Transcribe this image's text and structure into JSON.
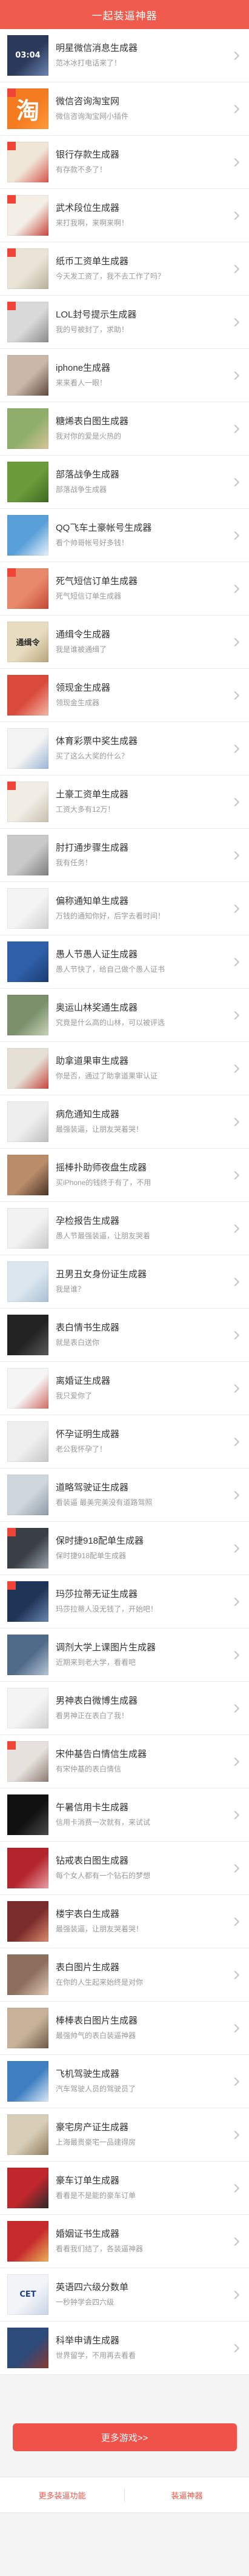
{
  "header": {
    "title": "一起装逼神器"
  },
  "colors": {
    "accent": "#ee5a4c",
    "button": "#f0524a",
    "badge": "#f04438"
  },
  "list": {
    "items": [
      {
        "title": "明星微信消息生成器",
        "subtitle": "范冰冰打电话来了！",
        "thumb": {
          "bg": "#2b3a5a",
          "accent": "#6b86b3",
          "text": "03:04",
          "color": "#ffffff"
        },
        "badge": false
      },
      {
        "title": "微信咨询淘宝网",
        "subtitle": "微信咨询淘宝网小插件",
        "thumb": {
          "bg": "#f57b20",
          "accent": "#ff9a3c",
          "text": "淘",
          "color": "#ffffff"
        },
        "badge": true
      },
      {
        "title": "银行存款生成器",
        "subtitle": "有存款不多了！",
        "thumb": {
          "bg": "#efe6d8",
          "accent": "#d9534a"
        },
        "badge": true
      },
      {
        "title": "武术段位生成器",
        "subtitle": "来打我啊，来啊来啊！",
        "thumb": {
          "bg": "#f3efe6",
          "accent": "#c9453c"
        },
        "badge": true
      },
      {
        "title": "纸币工资单生成器",
        "subtitle": "今天发工资了，我不去工作了吗？",
        "thumb": {
          "bg": "#e9e4d6",
          "accent": "#b9b09a"
        },
        "badge": true
      },
      {
        "title": "LOL封号提示生成器",
        "subtitle": "我的号被封了，求助！",
        "thumb": {
          "bg": "#d9d9d9",
          "accent": "#8a8a8a"
        },
        "badge": true
      },
      {
        "title": "iphone生成器",
        "subtitle": "来来看人一眼！",
        "thumb": {
          "bg": "#c9b7a8",
          "accent": "#5e4a40"
        },
        "badge": false
      },
      {
        "title": "糖烯表白图生成器",
        "subtitle": "我对你的爱是火热的",
        "thumb": {
          "bg": "#8fae6b",
          "accent": "#d8c49a"
        },
        "badge": false
      },
      {
        "title": "部落战争生成器",
        "subtitle": "部落战争生成器",
        "thumb": {
          "bg": "#6a9c3c",
          "accent": "#3d6a1f"
        },
        "badge": false
      },
      {
        "title": "QQ飞车土豪帐号生成器",
        "subtitle": "看个帅哥帐号好多钱！",
        "thumb": {
          "bg": "#5aa0d8",
          "accent": "#e9f2fa"
        },
        "badge": false
      },
      {
        "title": "死气短信订单生成器",
        "subtitle": "死气短信订单生成器",
        "thumb": {
          "bg": "#e9896b",
          "accent": "#c24a34"
        },
        "badge": true
      },
      {
        "title": "通缉令生成器",
        "subtitle": "我是谁被通缉了",
        "thumb": {
          "bg": "#e8dcc0",
          "accent": "#b9a57c",
          "text": "通缉令",
          "color": "#2a2a2a"
        },
        "badge": false
      },
      {
        "title": "领现金生成器",
        "subtitle": "领现金生成器",
        "thumb": {
          "bg": "#d94a3b",
          "accent": "#f2b9a8"
        },
        "badge": false
      },
      {
        "title": "体育彩票中奖生成器",
        "subtitle": "买了这么大奖的什么？",
        "thumb": {
          "bg": "#f3f3f3",
          "accent": "#9bb6d8"
        },
        "badge": false
      },
      {
        "title": "土豪工资单生成器",
        "subtitle": "工资大多有12万！",
        "thumb": {
          "bg": "#f1ede5",
          "accent": "#c7bfae"
        },
        "badge": true
      },
      {
        "title": "肘打通步骤生成器",
        "subtitle": "我有任务！",
        "thumb": {
          "bg": "#c9c9c9",
          "accent": "#7d7d7d"
        },
        "badge": false
      },
      {
        "title": "偏称通知单生成器",
        "subtitle": "万钱的通知你好，后字去看时间！",
        "thumb": {
          "bg": "#f4f4f4",
          "accent": "#cfcfcf"
        },
        "badge": false
      },
      {
        "title": "愚人节愚人证生成器",
        "subtitle": "愚人节快了，给自己做个愚人证书",
        "thumb": {
          "bg": "#2f5fa8",
          "accent": "#1b3b70"
        },
        "badge": false
      },
      {
        "title": "奥运山林奖通生成器",
        "subtitle": "究竟是什么高的山林，可以被评选",
        "thumb": {
          "bg": "#7a8f6a",
          "accent": "#c9d3b8"
        },
        "badge": false
      },
      {
        "title": "助拿道果审生成器",
        "subtitle": "你是否，通过了助拿道果审认证",
        "thumb": {
          "bg": "#e5e0d6",
          "accent": "#c9453c"
        },
        "badge": false
      },
      {
        "title": "病危通知生成器",
        "subtitle": "最强装逼，让朋友哭着哭！",
        "thumb": {
          "bg": "#eeeeee",
          "accent": "#bdbdbd"
        },
        "badge": false
      },
      {
        "title": "摇棒扑助师夜盘生成器",
        "subtitle": "买iPhone的钱终于有了，不用",
        "thumb": {
          "bg": "#b98c6a",
          "accent": "#4a3426"
        },
        "badge": false
      },
      {
        "title": "孕检报告生成器",
        "subtitle": "愚人节最强装逼，让朋友哭着",
        "thumb": {
          "bg": "#f2f2f2",
          "accent": "#c8c8c8"
        },
        "badge": false
      },
      {
        "title": "丑男丑女身份证生成器",
        "subtitle": "我是谁？",
        "thumb": {
          "bg": "#dbe6ef",
          "accent": "#a9bfd2"
        },
        "badge": false
      },
      {
        "title": "表白情书生成器",
        "subtitle": "就是表白送你",
        "thumb": {
          "bg": "#222222",
          "accent": "#5a5a5a"
        },
        "badge": false
      },
      {
        "title": "离婚证生成器",
        "subtitle": "我只爱你了",
        "thumb": {
          "bg": "#f5f5f5",
          "accent": "#d26b63"
        },
        "badge": false
      },
      {
        "title": "怀孕证明生成器",
        "subtitle": "老公我怀孕了！",
        "thumb": {
          "bg": "#efefef",
          "accent": "#c6c6c6"
        },
        "badge": false
      },
      {
        "title": "道略驾驶证生成器",
        "subtitle": "看装逼 最美完美没有道路驾照",
        "thumb": {
          "bg": "#cfd6dc",
          "accent": "#8d9aa6"
        },
        "badge": false
      },
      {
        "title": "保时捷918配单生成器",
        "subtitle": "保时捷918配单生成器",
        "thumb": {
          "bg": "#3a3f45",
          "accent": "#9aa3ad"
        },
        "badge": true
      },
      {
        "title": "玛莎拉蒂无证生成器",
        "subtitle": "玛莎拉蒂人没无钱了，开始吧！",
        "thumb": {
          "bg": "#1f3558",
          "accent": "#6a86b0"
        },
        "badge": true
      },
      {
        "title": "调剂大学上课图片生成器",
        "subtitle": "近期来到老大学，看看吧",
        "thumb": {
          "bg": "#506a8a",
          "accent": "#b8c6d6"
        },
        "badge": false
      },
      {
        "title": "男神表白微博生成器",
        "subtitle": "看男神正在表白了我！",
        "thumb": {
          "bg": "#f4f4f4",
          "accent": "#d0d0d0"
        },
        "badge": false
      },
      {
        "title": "宋仲基告白情信生成器",
        "subtitle": "有宋仲基的表白情信",
        "thumb": {
          "bg": "#e6e1dd",
          "accent": "#8c7b70"
        },
        "badge": true
      },
      {
        "title": "午暑信用卡生成器",
        "subtitle": "信用卡消费一次就有，来试试",
        "thumb": {
          "bg": "#101010",
          "accent": "#4a4a4a"
        },
        "badge": false
      },
      {
        "title": "钻戒表白图生成器",
        "subtitle": "每个女人都有一个钻石的梦想",
        "thumb": {
          "bg": "#b3252d",
          "accent": "#e8a0a4"
        },
        "badge": false
      },
      {
        "title": "楼宇表白生成器",
        "subtitle": "最强装逼，让朋友哭着哭！",
        "thumb": {
          "bg": "#7a2b2b",
          "accent": "#d98c6a"
        },
        "badge": false
      },
      {
        "title": "表白图片生成器",
        "subtitle": "在你的人生起来始终是对你",
        "thumb": {
          "bg": "#8c6f5c",
          "accent": "#e2cbb6"
        },
        "badge": false
      },
      {
        "title": "棒棒表白图片生成器",
        "subtitle": "最强帅气的表白装逼神器",
        "thumb": {
          "bg": "#c7b299",
          "accent": "#6e5a47"
        },
        "badge": false
      },
      {
        "title": "飞机驾驶生成器",
        "subtitle": "汽车驾驶人员的驾驶员了",
        "thumb": {
          "bg": "#3f7fc1",
          "accent": "#dbe9f6"
        },
        "badge": false
      },
      {
        "title": "豪宅房产证生成器",
        "subtitle": "上海最贵豪宅一品建得房",
        "thumb": {
          "bg": "#d8cdb7",
          "accent": "#8f7d5e"
        },
        "badge": false
      },
      {
        "title": "豪车订单生成器",
        "subtitle": "看看是不是能的豪车订单",
        "thumb": {
          "bg": "#c0282d",
          "accent": "#2a2a2a"
        },
        "badge": false
      },
      {
        "title": "婚姻证书生成器",
        "subtitle": "看看我们结了，各装逼神器",
        "thumb": {
          "bg": "#c62a2a",
          "accent": "#e9b35a"
        },
        "badge": false
      },
      {
        "title": "英语四六级分数单",
        "subtitle": "一秒钟学会四六级",
        "thumb": {
          "bg": "#f2f4f8",
          "accent": "#c9d3e6",
          "text": "CET",
          "color": "#1f3f8f"
        },
        "badge": false
      },
      {
        "title": "科举申请生成器",
        "subtitle": "世界留学，不用再去看看",
        "thumb": {
          "bg": "#2c4a7a",
          "accent": "#8a3a2e"
        },
        "badge": false
      }
    ]
  },
  "more_button": {
    "label": "更多游戏>>"
  },
  "footer": {
    "links": [
      "更多装逼功能",
      "装逼神器"
    ]
  }
}
